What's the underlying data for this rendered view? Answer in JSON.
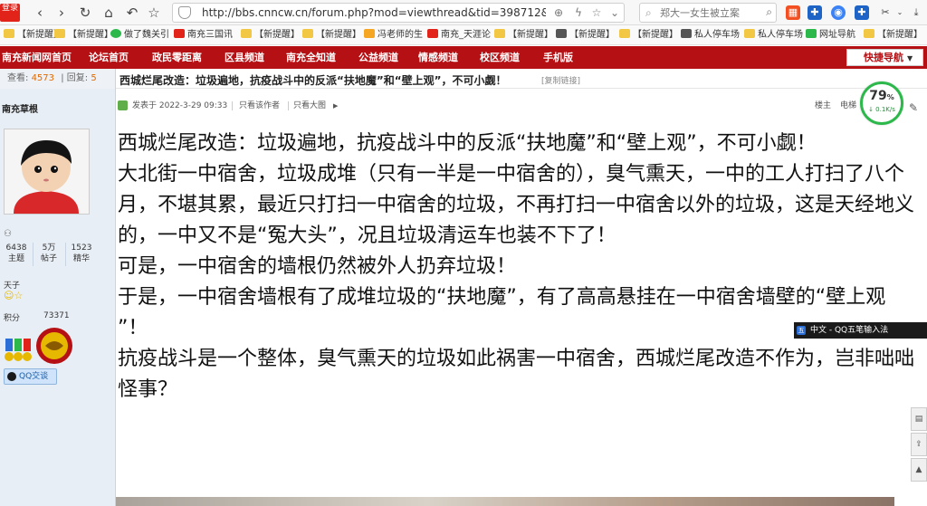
{
  "browser": {
    "login_badge": "登录",
    "url": "http://bbs.cnncw.cn/forum.php?mod=viewthread&tid=398712&pid=180425",
    "search_placeholder": "郑大一女生被立案"
  },
  "bookmarks": [
    "【新提醒】",
    "【新提醒】",
    "做了魏关引",
    "南充三国讯",
    "【新提醒】",
    "【新提醒】",
    "冯老师的生",
    "南充_天涯论",
    "【新提醒】",
    "【新提醒】",
    "【新提醒】",
    "私人停车场",
    "私人停车场",
    "网址导航",
    "【新提醒】"
  ],
  "site_nav": {
    "items": [
      "南充新闻网首页",
      "论坛首页",
      "政民零距离",
      "区县频道",
      "南充全知道",
      "公益频道",
      "情感频道",
      "校区频道",
      "手机版"
    ],
    "quick_nav": "快捷导航"
  },
  "thread": {
    "views_label": "查看:",
    "views": "4573",
    "replies_label": "回复:",
    "replies": "5",
    "title": "西城烂尾改造：垃圾遍地，抗疫战斗中的反派“扶地魔”和“壁上观”，不可小觑！",
    "copy_link": "[复制链接]"
  },
  "user": {
    "name": "南充草根",
    "topics": "6438",
    "topics_label": "主题",
    "posts": "5万",
    "posts_label": "帖子",
    "elite": "1523",
    "elite_label": "精华",
    "rank": "天子",
    "credits_label": "积分",
    "credits": "73371",
    "qq_button": "QQ交谈"
  },
  "post": {
    "posted_at": "发表于 2022-3-29 09:33",
    "author_only": "只看该作者",
    "big_image": "只看大图",
    "floor": "楼主",
    "elevator": "电梯",
    "paragraphs": [
      "西城烂尾改造：垃圾遍地，抗疫战斗中的反派“扶地魔”和“壁上观”，不可小觑！",
      "大北街一中宿舍，垃圾成堆（只有一半是一中宿舍的），臭气熏天，一中的工人打扫了八个月，不堪其累，最近只打扫一中宿舍的垃圾，不再打扫一中宿舍以外的垃圾，这是天经地义的，一中又不是“冤大头”，况且垃圾清运车也装不下了！",
      "可是，一中宿舍的墙根仍然被外人扔弃垃圾！",
      "于是，一中宿舍墙根有了成堆垃圾的“扶地魔”，有了高高悬挂在一中宿舍墙壁的“壁上观 ”！",
      "抗疫战斗是一个整体，臭气熏天的垃圾如此祸害一中宿舍，西城烂尾改造不作为，岂非咄咄怪事？"
    ]
  },
  "speed_widget": {
    "percent": "79",
    "percent_unit": "%",
    "rate": "↓ 0.1K/s"
  },
  "ime": {
    "label": "中文 - QQ五笔输入法"
  },
  "colors": {
    "site_red": "#b51014",
    "sidebar_bg": "#e8eef5",
    "accent_green": "#2db84b"
  }
}
